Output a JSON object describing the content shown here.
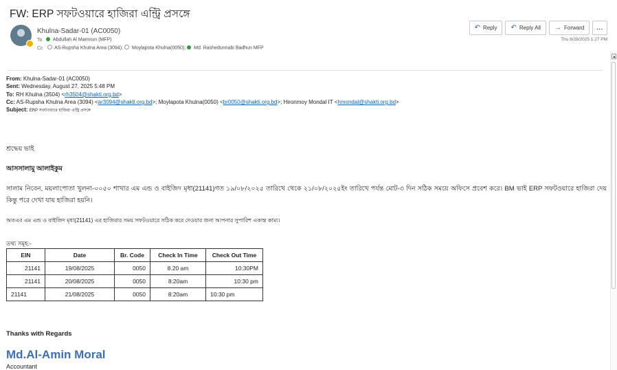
{
  "email": {
    "subject": "FW: ERP সফটওয়ারে হাজিরা এন্ট্রি প্রসঙ্গে",
    "sender": "Khulna-Sadar-01 (AC0050)",
    "to_label": "To",
    "to": "Abdullah Al Mamnun (MFP)",
    "cc_label": "Cc",
    "cc": [
      {
        "name": "AS-Rupsha Khulna Area (3094);",
        "status": "grey"
      },
      {
        "name": "Moylapota Khulna(0050);",
        "status": "grey"
      },
      {
        "name": "Md. Rashedunnabi Badhun MFP",
        "status": "green"
      }
    ],
    "timestamp": "Thu 8/28/2025 1:27 PM"
  },
  "actions": {
    "reply": "Reply",
    "reply_all": "Reply All",
    "forward": "Forward",
    "more": "..."
  },
  "forwarded": {
    "from_label": "From:",
    "from": "Khulna-Sadar-01 (AC0050)",
    "sent_label": "Sent:",
    "sent": "Wednesday, August 27, 2025 5:48 PM",
    "to_label": "To:",
    "to_name": "RH Khulna (3504) <",
    "to_email": "rh3504@shakti.org.bd",
    "to_end": ">",
    "cc_label": "Cc:",
    "cc1_name": "AS-Rupsha Khulna Area (3094) <",
    "cc1_email": "ar3094@shakti.org.bd",
    "cc2_name": ">; Moylapota Khulna(0050) <",
    "cc2_email": "br0050@shakti.org.bd",
    "cc3_name": ">; Hironmoy Mondal IT <",
    "cc3_email": "hmondal@shakti.org.bd",
    "cc_end": ">",
    "subject_label": "Subject:",
    "subject": "ERP সফটওয়ারে হাজিরা এন্ট্রি প্রসঙ্গে"
  },
  "body": {
    "greeting": "শ্রদ্ধেয় ভাই",
    "salam": "আসসালামু আলাইকুম",
    "para1": "সালাম নিবেন, ময়লাপোতা খুলনা-০০৫০ শাখার এম এন্ড ও বাইজিদ মৃধা(21141)গত ১৯/০৮/২০২৫ তারিখে থেকে ২১/০৮/২০২৫ইং তারিখে পর্যন্ত মোট-৩ দিন  সঠিক সময়ে অফিসে প্রবেশ করে। BM ভাই ERP সফটওয়ারে হাজিরা দেয় কিন্তু পরে দেখা যায় হাজিরা হয়নি।",
    "para2": "অতএব এম এন্ড ও বাইজিদ মৃধা(21141) এর হাজিরার সময় সফটওয়ারে সঠিক করে দেওয়ার জন্য আপনার সুপারিশ একান্ত কাম্য।",
    "info_heading": "তথ্য সমূহ:-"
  },
  "table": {
    "headers": [
      "EIN",
      "Date",
      "Br. Code",
      "Check In Time",
      "Check Out Time"
    ],
    "rows": [
      [
        "21141",
        "19/08/2025",
        "0050",
        "8.20 am",
        "10:30PM"
      ],
      [
        "21141",
        "20/08/2025",
        "0050",
        "8:20am",
        "10:30 pm"
      ],
      [
        "21141",
        "21/08/2025",
        "0050",
        "8:20am",
        "10:30 pm"
      ]
    ]
  },
  "signature": {
    "thanks": "Thanks with Regards",
    "name": "Md.Al-Amin Moral",
    "role": "Accountant"
  },
  "colors": {
    "accent": "#2f66b3",
    "link": "#0563c1",
    "signature": "#3c6fb6",
    "presence_away": "#f0b400",
    "presence_available": "#3a9a3a"
  },
  "icons": {
    "reply": "reply-icon",
    "reply_all": "reply-all-icon",
    "forward": "forward-icon",
    "more": "more-icon",
    "scroll_up": "chevron-up-icon"
  }
}
